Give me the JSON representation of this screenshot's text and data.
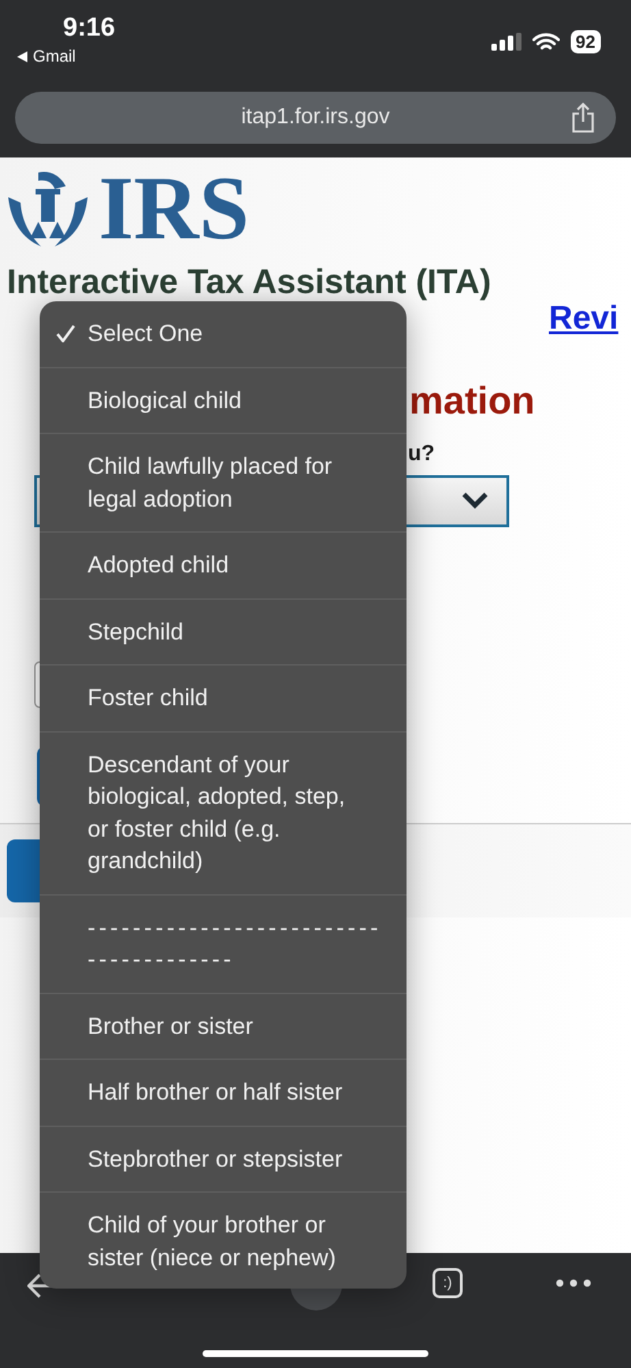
{
  "status_bar": {
    "time": "9:16",
    "back_app": "Gmail",
    "battery": "92"
  },
  "browser": {
    "url": "itap1.for.irs.gov"
  },
  "page": {
    "logo_text": "IRS",
    "title": "Interactive Tax Assistant (ITA)",
    "link": "Revi",
    "heading_fragment": "mation",
    "question_fragment": "u?"
  },
  "dropdown_menu": {
    "options": [
      {
        "label": "Select One",
        "selected": true
      },
      {
        "label": "Biological child",
        "selected": false
      },
      {
        "label": "Child lawfully placed for legal adoption",
        "selected": false
      },
      {
        "label": "Adopted child",
        "selected": false
      },
      {
        "label": "Stepchild",
        "selected": false
      },
      {
        "label": "Foster child",
        "selected": false
      },
      {
        "label": "Descendant of your biological, adopted, step, or foster child (e.g. grandchild)",
        "selected": false
      },
      {
        "label": "---------------------------------------",
        "selected": false,
        "kind": "separator"
      },
      {
        "label": "Brother or sister",
        "selected": false
      },
      {
        "label": "Half brother or half sister",
        "selected": false
      },
      {
        "label": "Stepbrother or stepsister",
        "selected": false
      },
      {
        "label": "Child of your brother or sister (niece or nephew)",
        "selected": false
      }
    ]
  },
  "toolbar": {
    "tabs_label": ":)"
  }
}
